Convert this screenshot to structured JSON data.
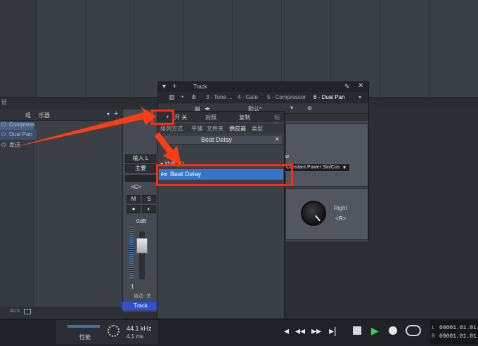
{
  "pan_window": {
    "title": "Track",
    "tabs": [
      "3 - Tone ...",
      "4 - Gate",
      "5 - Compressor",
      "6 - Dual Pan"
    ],
    "toolbar_preset": "默认*",
    "toolbar_labels": [
      "开 关",
      "对照",
      "复制",
      "粘贴"
    ],
    "curve_label": "w",
    "curve_select": "Constant Power Sin/Cos",
    "right_label": "Right",
    "right_value": "<R>"
  },
  "browser": {
    "tabs": [
      "排列方式",
      "平铺",
      "文件夹",
      "供应商",
      "类型"
    ],
    "search_text": "Beat Delay",
    "category": "▾ 插件 (1)",
    "item_prefix": "FX",
    "item_label": "Beat Delay"
  },
  "mixer": {
    "header_group": "组",
    "header_instrument": "乐器",
    "aux_label": "AUX",
    "left_scroll_text": "徒"
  },
  "strip": {
    "inserts": [
      "Compress",
      "Dual Pan"
    ],
    "sends_label": "发送",
    "input_label": "输入 L",
    "output_label": "主要",
    "pan_value": "<C>",
    "mute": "M",
    "solo": "S",
    "volume": "0dB",
    "number": "1",
    "auto_label": "自动: 关",
    "track_label": "Track"
  },
  "transport": {
    "perf_label": "性能",
    "sample_rate": "44.1 kHz",
    "latency": "4.1 ms",
    "time_L": "00001.01.01.",
    "time_R": "00001.01.01.",
    "marker_L": "L",
    "marker_R": "R"
  },
  "colors": {
    "accent_blue": "#3574c8",
    "highlight_red": "#ff2a10",
    "play_green": "#3ad641",
    "track_blue": "#2f4fd4"
  }
}
